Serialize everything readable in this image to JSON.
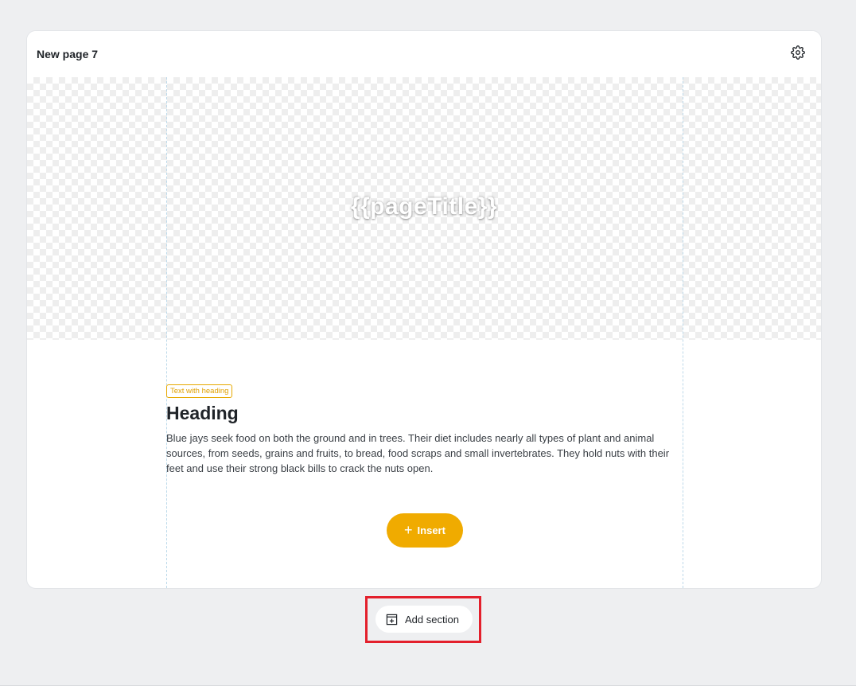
{
  "card": {
    "title": "New page 7",
    "settings_icon": "gear-icon"
  },
  "hero": {
    "title": "{{pageTitle}}"
  },
  "text_section": {
    "tag": "Text with heading",
    "heading": "Heading",
    "body": "Blue jays seek food on both the ground and in trees. Their diet includes nearly all types of plant and animal sources, from seeds, grains and fruits, to bread, food scraps and small invertebrates. They hold nuts with their feet and use their strong black bills to crack the nuts open."
  },
  "insert_button": {
    "label": "Insert",
    "icon": "plus-icon",
    "color": "#f0ab00"
  },
  "add_section": {
    "label": "Add section",
    "icon": "add-section-icon",
    "highlight_color": "#e3202c"
  }
}
